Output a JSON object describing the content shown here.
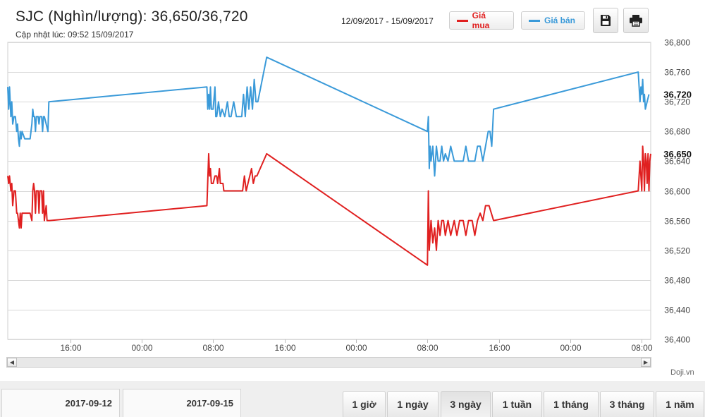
{
  "header": {
    "title": "SJC (Nghìn/lượng): 36,650/36,720",
    "updated": "Cập nhật lúc: 09:52 15/09/2017",
    "date_range": "12/09/2017 - 15/09/2017",
    "legend_buy": "Giá mua",
    "legend_sell": "Giá bán",
    "save_icon": "floppy-disk-icon",
    "print_icon": "printer-icon"
  },
  "colors": {
    "buy": "#e02020",
    "sell": "#3a9ad9",
    "grid": "#d8d8d8"
  },
  "source": "Doji.vn",
  "navigator": {
    "from": "2017-09-12",
    "to": "2017-09-15"
  },
  "range_buttons": [
    "1 giờ",
    "1 ngày",
    "3 ngày",
    "1 tuần",
    "1 tháng",
    "3 tháng",
    "1 năm"
  ],
  "active_range": "3 ngày",
  "chart_data": {
    "type": "line",
    "ylim": [
      36400,
      36800
    ],
    "y_ticks": [
      "36,400",
      "36,440",
      "36,480",
      "36,520",
      "36,560",
      "36,600",
      "36,640",
      "36,680",
      "36,720",
      "36,760",
      "36,800"
    ],
    "x_ticks": [
      "16:00",
      "00:00",
      "08:00",
      "16:00",
      "00:00",
      "08:00",
      "16:00",
      "00:00",
      "08:00"
    ],
    "x_tick_hours": [
      16,
      24,
      32,
      40,
      48,
      56,
      64,
      72,
      80
    ],
    "x_range_hours": [
      9.0,
      81.0
    ],
    "grid": true,
    "last_buy_label": "36,650",
    "last_sell_label": "36,720",
    "series": [
      {
        "name": "Giá mua",
        "color": "#e02020",
        "points": [
          [
            9.0,
            36620
          ],
          [
            9.1,
            36610
          ],
          [
            9.2,
            36620
          ],
          [
            9.35,
            36600
          ],
          [
            9.45,
            36610
          ],
          [
            9.55,
            36580
          ],
          [
            9.7,
            36600
          ],
          [
            9.85,
            36600
          ],
          [
            10.0,
            36570
          ],
          [
            10.1,
            36570
          ],
          [
            10.2,
            36560
          ],
          [
            10.3,
            36550
          ],
          [
            10.4,
            36570
          ],
          [
            10.5,
            36550
          ],
          [
            10.6,
            36570
          ],
          [
            10.9,
            36570
          ],
          [
            11.2,
            36570
          ],
          [
            11.5,
            36570
          ],
          [
            11.7,
            36560
          ],
          [
            11.8,
            36600
          ],
          [
            11.9,
            36610
          ],
          [
            12.0,
            36600
          ],
          [
            12.1,
            36570
          ],
          [
            12.2,
            36600
          ],
          [
            12.4,
            36600
          ],
          [
            12.5,
            36570
          ],
          [
            12.6,
            36600
          ],
          [
            12.8,
            36600
          ],
          [
            12.9,
            36570
          ],
          [
            13.0,
            36600
          ],
          [
            13.1,
            36560
          ],
          [
            13.3,
            36580
          ],
          [
            13.4,
            36560
          ],
          [
            13.7,
            36560
          ],
          [
            31.3,
            36580
          ],
          [
            31.5,
            36650
          ],
          [
            31.6,
            36620
          ],
          [
            31.7,
            36630
          ],
          [
            31.8,
            36610
          ],
          [
            32.0,
            36610
          ],
          [
            32.2,
            36620
          ],
          [
            32.4,
            36620
          ],
          [
            32.5,
            36610
          ],
          [
            32.7,
            36630
          ],
          [
            32.8,
            36610
          ],
          [
            33.1,
            36610
          ],
          [
            33.2,
            36600
          ],
          [
            33.5,
            36600
          ],
          [
            34.0,
            36600
          ],
          [
            34.5,
            36600
          ],
          [
            35.3,
            36600
          ],
          [
            35.5,
            36620
          ],
          [
            35.7,
            36600
          ],
          [
            35.9,
            36610
          ],
          [
            36.1,
            36620
          ],
          [
            36.3,
            36630
          ],
          [
            36.5,
            36610
          ],
          [
            36.7,
            36620
          ],
          [
            36.9,
            36620
          ],
          [
            38.0,
            36650
          ],
          [
            56.0,
            36500
          ],
          [
            56.1,
            36600
          ],
          [
            56.2,
            36520
          ],
          [
            56.3,
            36540
          ],
          [
            56.4,
            36560
          ],
          [
            56.6,
            36530
          ],
          [
            56.8,
            36550
          ],
          [
            57.0,
            36520
          ],
          [
            57.2,
            36560
          ],
          [
            57.4,
            36540
          ],
          [
            57.6,
            36560
          ],
          [
            57.8,
            36560
          ],
          [
            58.0,
            36540
          ],
          [
            58.3,
            36560
          ],
          [
            58.6,
            36540
          ],
          [
            59.0,
            36560
          ],
          [
            59.3,
            36540
          ],
          [
            59.6,
            36560
          ],
          [
            60.0,
            36560
          ],
          [
            60.3,
            36540
          ],
          [
            60.6,
            36560
          ],
          [
            61.0,
            36560
          ],
          [
            61.3,
            36540
          ],
          [
            61.6,
            36560
          ],
          [
            61.9,
            36570
          ],
          [
            62.2,
            36560
          ],
          [
            62.5,
            36580
          ],
          [
            62.9,
            36580
          ],
          [
            63.4,
            36560
          ],
          [
            79.6,
            36600
          ],
          [
            79.8,
            36640
          ],
          [
            79.9,
            36620
          ],
          [
            80.0,
            36600
          ],
          [
            80.1,
            36660
          ],
          [
            80.2,
            36640
          ],
          [
            80.3,
            36600
          ],
          [
            80.4,
            36650
          ],
          [
            80.5,
            36640
          ],
          [
            80.6,
            36610
          ],
          [
            80.7,
            36650
          ],
          [
            80.8,
            36600
          ],
          [
            80.9,
            36640
          ],
          [
            81.0,
            36650
          ]
        ]
      },
      {
        "name": "Giá bán",
        "color": "#3a9ad9",
        "points": [
          [
            9.0,
            36740
          ],
          [
            9.1,
            36710
          ],
          [
            9.2,
            36740
          ],
          [
            9.35,
            36700
          ],
          [
            9.45,
            36720
          ],
          [
            9.55,
            36690
          ],
          [
            9.7,
            36700
          ],
          [
            9.85,
            36700
          ],
          [
            10.0,
            36680
          ],
          [
            10.1,
            36690
          ],
          [
            10.2,
            36670
          ],
          [
            10.3,
            36660
          ],
          [
            10.4,
            36680
          ],
          [
            10.5,
            36670
          ],
          [
            10.6,
            36680
          ],
          [
            10.9,
            36670
          ],
          [
            11.2,
            36670
          ],
          [
            11.5,
            36670
          ],
          [
            11.7,
            36690
          ],
          [
            11.8,
            36710
          ],
          [
            11.9,
            36700
          ],
          [
            12.0,
            36700
          ],
          [
            12.1,
            36680
          ],
          [
            12.2,
            36700
          ],
          [
            12.4,
            36700
          ],
          [
            12.5,
            36690
          ],
          [
            12.6,
            36700
          ],
          [
            12.8,
            36700
          ],
          [
            12.9,
            36680
          ],
          [
            13.0,
            36700
          ],
          [
            13.1,
            36700
          ],
          [
            13.3,
            36690
          ],
          [
            13.5,
            36680
          ],
          [
            13.6,
            36720
          ],
          [
            31.3,
            36740
          ],
          [
            31.4,
            36710
          ],
          [
            31.5,
            36730
          ],
          [
            31.6,
            36710
          ],
          [
            31.7,
            36740
          ],
          [
            31.8,
            36710
          ],
          [
            32.0,
            36710
          ],
          [
            32.2,
            36740
          ],
          [
            32.3,
            36700
          ],
          [
            32.4,
            36700
          ],
          [
            32.6,
            36720
          ],
          [
            32.8,
            36700
          ],
          [
            33.0,
            36710
          ],
          [
            33.3,
            36700
          ],
          [
            33.6,
            36720
          ],
          [
            33.8,
            36700
          ],
          [
            34.0,
            36700
          ],
          [
            34.3,
            36720
          ],
          [
            34.6,
            36700
          ],
          [
            35.2,
            36700
          ],
          [
            35.4,
            36730
          ],
          [
            35.6,
            36700
          ],
          [
            35.8,
            36740
          ],
          [
            36.0,
            36710
          ],
          [
            36.2,
            36740
          ],
          [
            36.4,
            36710
          ],
          [
            36.6,
            36750
          ],
          [
            36.8,
            36720
          ],
          [
            37.0,
            36720
          ],
          [
            38.0,
            36780
          ],
          [
            56.0,
            36680
          ],
          [
            56.1,
            36700
          ],
          [
            56.2,
            36630
          ],
          [
            56.3,
            36660
          ],
          [
            56.4,
            36640
          ],
          [
            56.6,
            36660
          ],
          [
            56.8,
            36620
          ],
          [
            57.0,
            36660
          ],
          [
            57.2,
            36640
          ],
          [
            57.4,
            36640
          ],
          [
            57.6,
            36660
          ],
          [
            57.8,
            36640
          ],
          [
            58.0,
            36650
          ],
          [
            58.3,
            36640
          ],
          [
            58.6,
            36660
          ],
          [
            59.0,
            36640
          ],
          [
            59.5,
            36640
          ],
          [
            60.0,
            36640
          ],
          [
            60.3,
            36660
          ],
          [
            60.6,
            36640
          ],
          [
            61.0,
            36640
          ],
          [
            61.3,
            36640
          ],
          [
            61.6,
            36660
          ],
          [
            61.9,
            36660
          ],
          [
            62.2,
            36640
          ],
          [
            62.5,
            36660
          ],
          [
            62.8,
            36680
          ],
          [
            63.0,
            36680
          ],
          [
            63.2,
            36660
          ],
          [
            63.4,
            36710
          ],
          [
            79.6,
            36760
          ],
          [
            79.8,
            36720
          ],
          [
            79.9,
            36740
          ],
          [
            80.0,
            36730
          ],
          [
            80.1,
            36750
          ],
          [
            80.2,
            36720
          ],
          [
            80.3,
            36730
          ],
          [
            80.4,
            36710
          ],
          [
            80.6,
            36720
          ],
          [
            80.8,
            36730
          ]
        ]
      }
    ]
  }
}
